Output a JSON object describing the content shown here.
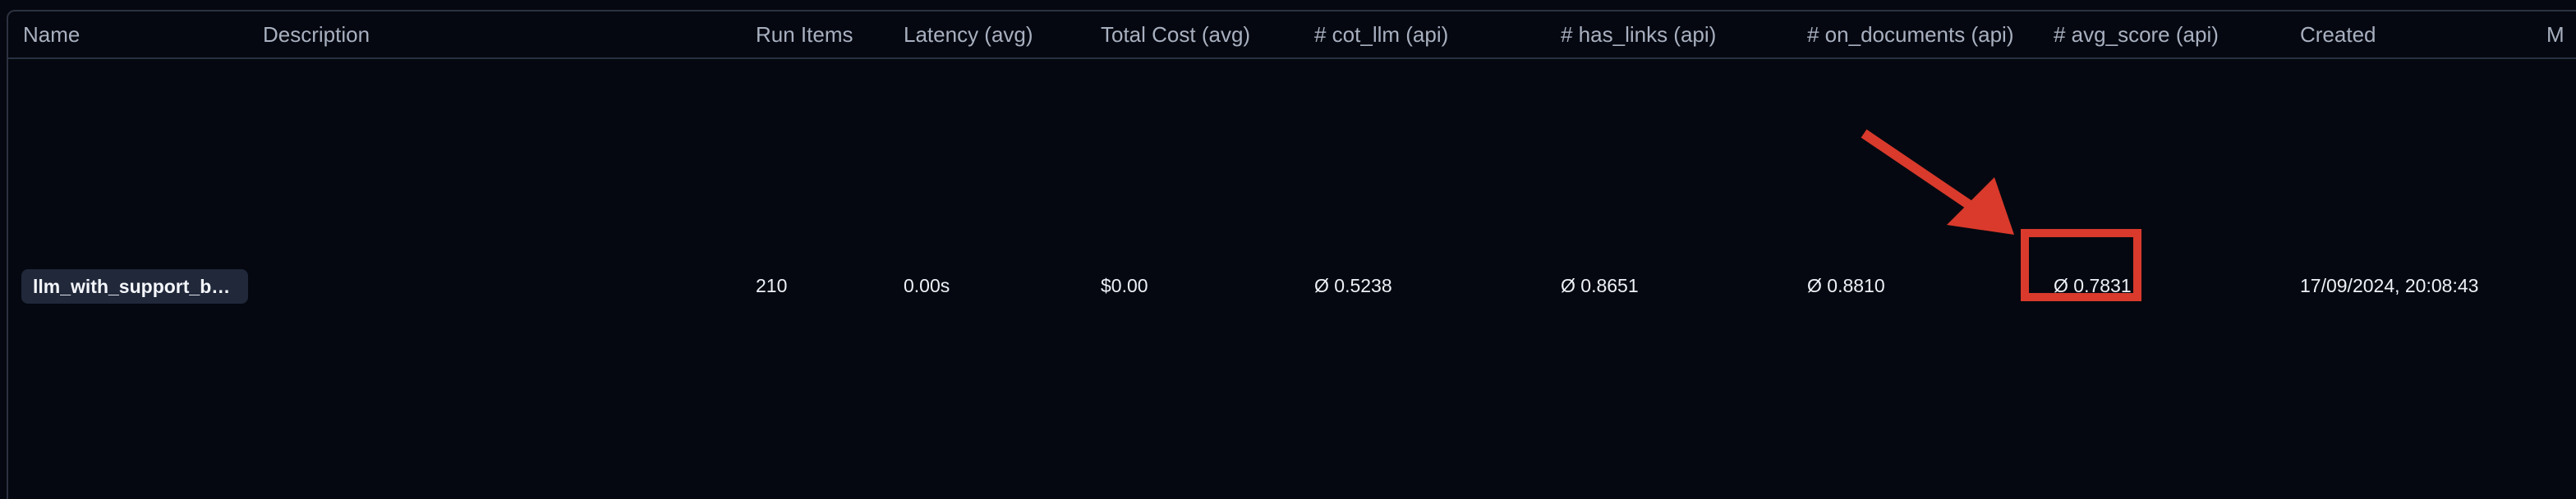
{
  "table": {
    "columns": [
      "Name",
      "Description",
      "Run Items",
      "Latency (avg)",
      "Total Cost (avg)",
      "# cot_llm (api)",
      "# has_links (api)",
      "# on_documents (api)",
      "# avg_score (api)",
      "Created",
      "M"
    ],
    "rows": [
      {
        "name": "llm_with_support_b…",
        "description": "",
        "run_items": "210",
        "latency": "0.00s",
        "total_cost": "$0.00",
        "cot_llm": "Ø 0.5238",
        "has_links": "Ø 0.8651",
        "on_documents": "Ø 0.8810",
        "avg_score": "Ø 0.7831",
        "created": "17/09/2024, 20:08:43"
      }
    ]
  },
  "annotation": {
    "color": "#d93a2c",
    "icon": "arrow-pointer-icon"
  }
}
